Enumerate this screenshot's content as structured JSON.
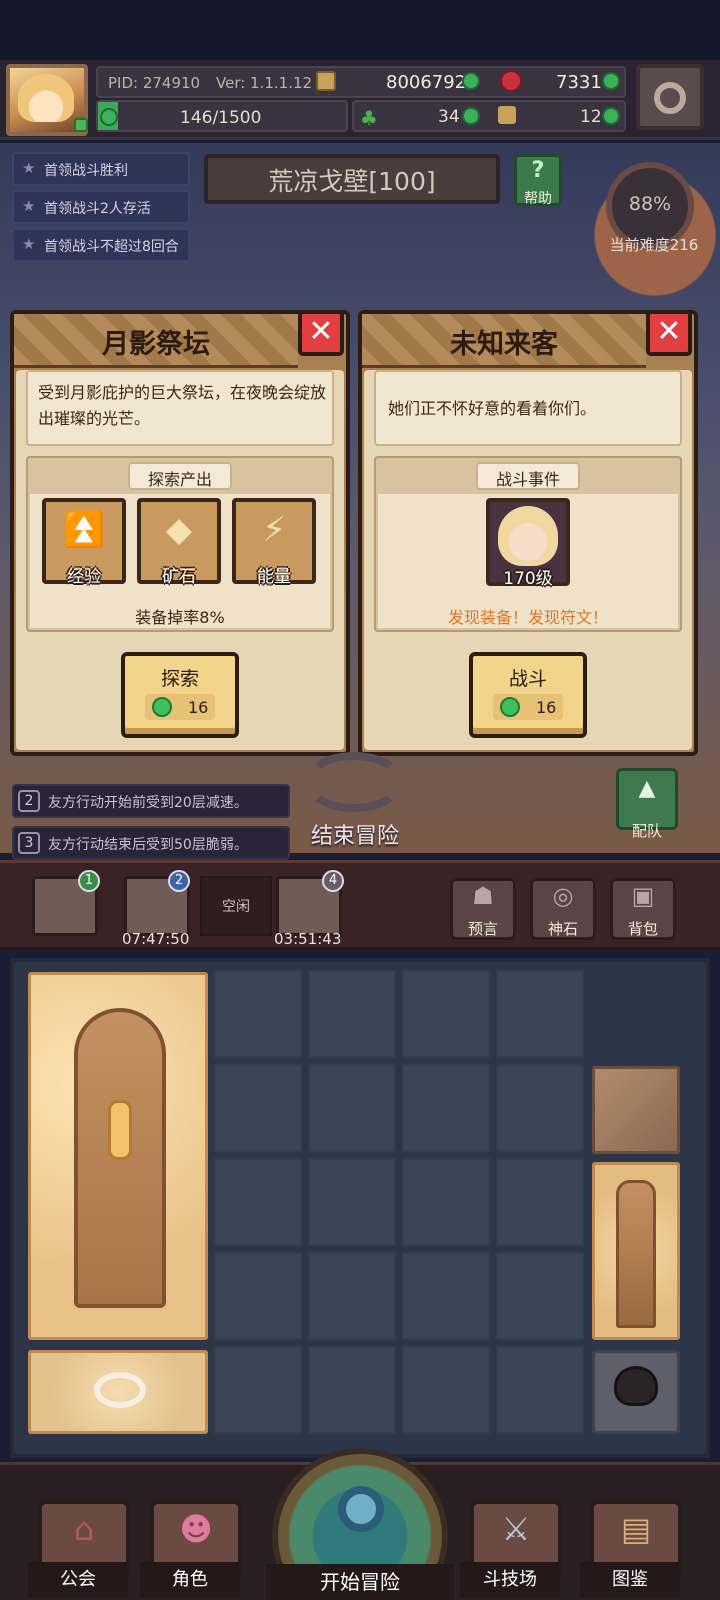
{
  "header": {
    "pid": "PID: 274910",
    "version": "Ver: 1.1.1.12",
    "gold": "8006792",
    "red_gems": "7331",
    "energy": "146/1500",
    "clover": "34",
    "boots": "12"
  },
  "quests": [
    {
      "label": "首领战斗胜利"
    },
    {
      "label": "首领战斗2人存活"
    },
    {
      "label": "首领战斗不超过8回合"
    }
  ],
  "area": {
    "name": "荒凉戈壁[100]",
    "help_label": "帮助",
    "help_icon": "?"
  },
  "difficulty": {
    "percent": "88%",
    "label": "当前难度216"
  },
  "card_left": {
    "title": "月影祭坛",
    "description": "受到月影庇护的巨大祭坛，在夜晚会绽放出璀璨的光芒。",
    "section_title": "探索产出",
    "products": [
      {
        "icon": "experience-icon",
        "glyph": "⏫",
        "label": "经验"
      },
      {
        "icon": "ore-icon",
        "glyph": "◆",
        "label": "矿石"
      },
      {
        "icon": "energy-bolt-icon",
        "glyph": "⚡",
        "label": "能量"
      }
    ],
    "drop_rate": "装备掉率8%",
    "action_label": "探索",
    "action_cost": "16"
  },
  "card_right": {
    "title": "未知来客",
    "description": "她们正不怀好意的看着你们。",
    "section_title": "战斗事件",
    "enemy_level": "170级",
    "discover": "发现装备！发现符文！",
    "action_label": "战斗",
    "action_cost": "16"
  },
  "effects": [
    {
      "num": "2",
      "text": "友方行动开始前受到20层减速。"
    },
    {
      "num": "3",
      "text": "友方行动结束后受到50层脆弱。"
    }
  ],
  "end_adventure": "结束冒险",
  "team_label": "配队",
  "slots": [
    {
      "badge": "1",
      "time": ""
    },
    {
      "badge": "2",
      "time": "07:47:50"
    },
    {
      "badge": "4",
      "time": "03:51:43"
    }
  ],
  "slot_empty": "空闲",
  "utilities": [
    {
      "icon": "prophecy-icon",
      "glyph": "☗",
      "label": "预言"
    },
    {
      "icon": "god-stone-icon",
      "glyph": "◎",
      "label": "神石"
    },
    {
      "icon": "backpack-icon",
      "glyph": "▣",
      "label": "背包"
    }
  ],
  "nav": {
    "guild": "公会",
    "character": "角色",
    "start": "开始冒险",
    "arena": "斗技场",
    "codex": "图鉴"
  },
  "colors": {
    "accent_gold": "#f2d48a",
    "card_bg": "#e6d6b6",
    "close_red": "#e24040",
    "gem_green": "#3fc05c",
    "discover_orange": "#d77a2a"
  }
}
